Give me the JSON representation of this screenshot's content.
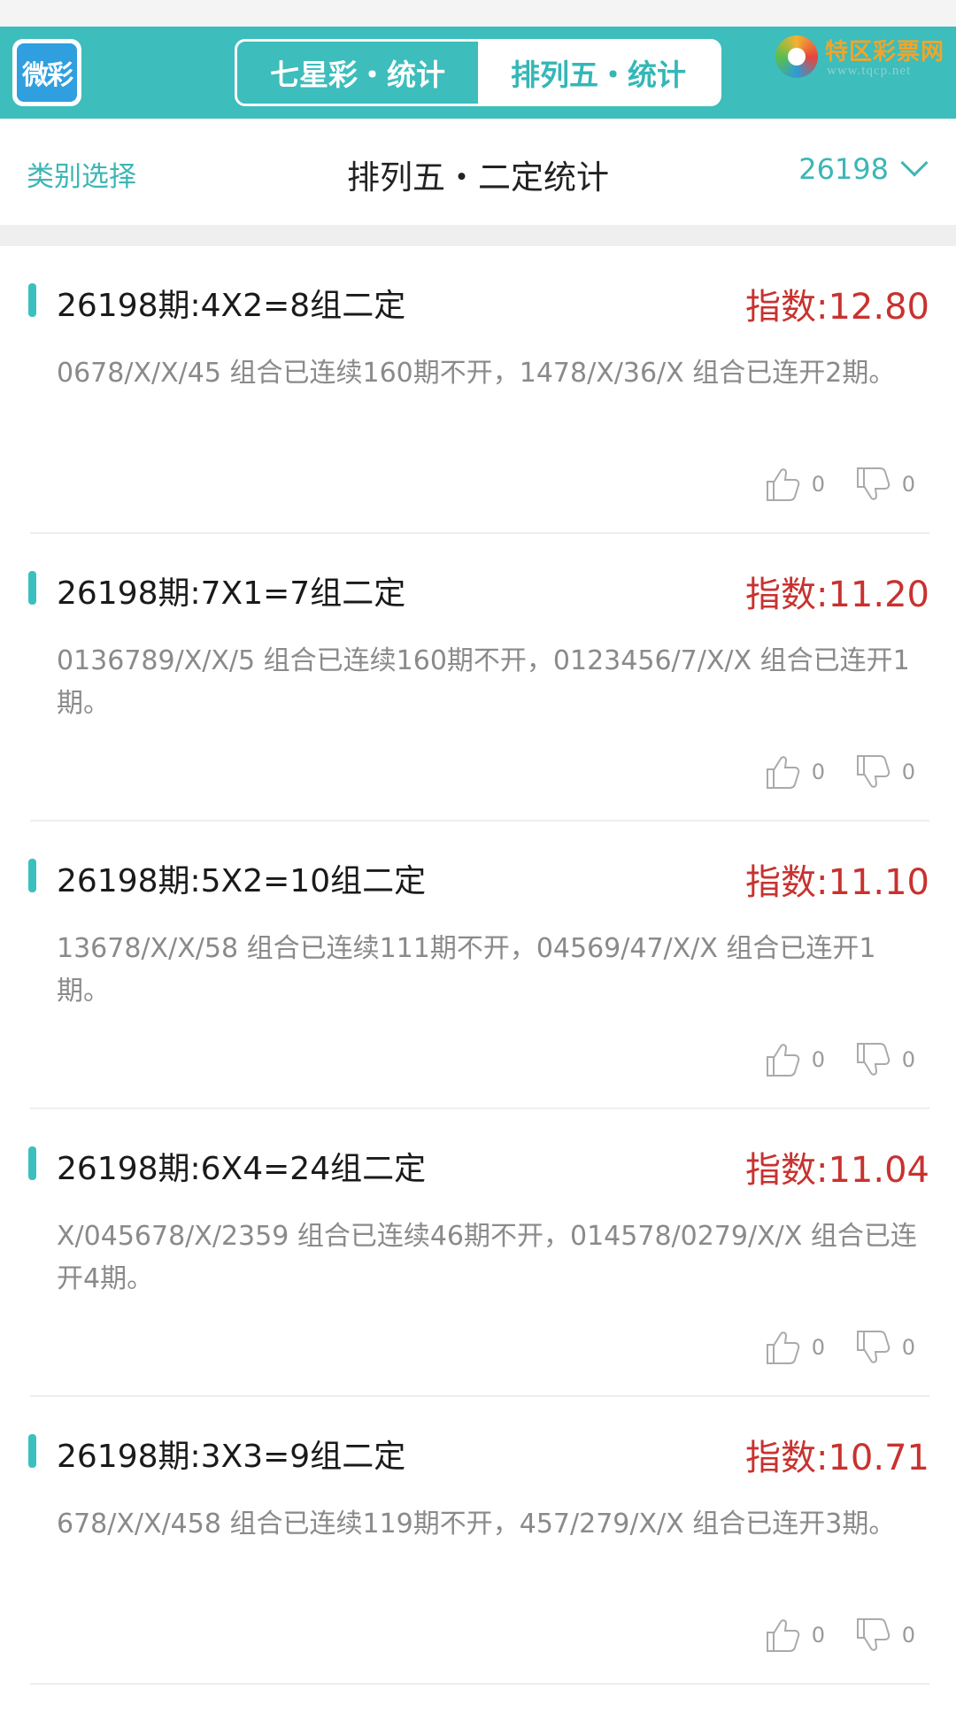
{
  "app": {
    "logo_text": "微彩"
  },
  "top_tabs": [
    {
      "label": "七星彩・统计",
      "active": false
    },
    {
      "label": "排列五・统计",
      "active": true
    }
  ],
  "watermark": {
    "title": "特区彩票网",
    "url": "www.tqcp.net"
  },
  "filter": {
    "left_label": "类别选择",
    "title": "排列五・二定统计",
    "period": "26198"
  },
  "cards": [
    {
      "title": "26198期:4X2=8组二定",
      "index": "指数:12.80",
      "desc": "0678/X/X/45 组合已连续160期不开，1478/X/36/X 组合已连开2期。",
      "likes": "0",
      "dislikes": "0"
    },
    {
      "title": "26198期:7X1=7组二定",
      "index": "指数:11.20",
      "desc": "0136789/X/X/5 组合已连续160期不开，0123456/7/X/X 组合已连开1期。",
      "likes": "0",
      "dislikes": "0"
    },
    {
      "title": "26198期:5X2=10组二定",
      "index": "指数:11.10",
      "desc": "13678/X/X/58 组合已连续111期不开，04569/47/X/X 组合已连开1期。",
      "likes": "0",
      "dislikes": "0"
    },
    {
      "title": "26198期:6X4=24组二定",
      "index": "指数:11.04",
      "desc": "X/045678/X/2359 组合已连续46期不开，014578/0279/X/X 组合已连开4期。",
      "likes": "0",
      "dislikes": "0"
    },
    {
      "title": "26198期:3X3=9组二定",
      "index": "指数:10.71",
      "desc": "678/X/X/458 组合已连续119期不开，457/279/X/X 组合已连开3期。",
      "likes": "0",
      "dislikes": "0"
    }
  ],
  "colors": {
    "teal": "#3dbdbc",
    "index_red": "#c8322f",
    "desc_gray": "#8a8a8a"
  }
}
